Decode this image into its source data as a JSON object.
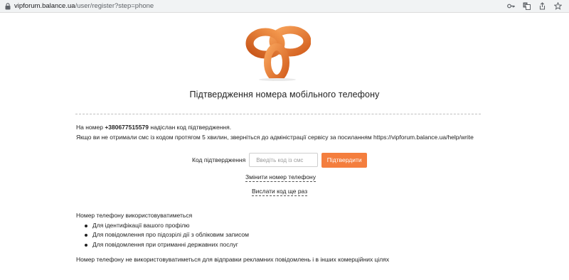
{
  "browser": {
    "url_host": "vipforum.balance.ua",
    "url_path": "/user/register?step=phone"
  },
  "page": {
    "title": "Підтвердження номера мобільного телефону",
    "info_prefix": "На номер ",
    "phone": "+380677515579",
    "info_suffix": " надіслан код підтвердження.",
    "info_line2": "Якщо ви не отримали смс із кодом протягом 5 хвилин, зверніться до адміністрації сервісу за посиланням https://vipforum.balance.ua/help/write"
  },
  "form": {
    "code_label": "Код підтвердження",
    "code_placeholder": "Введіть код із смс",
    "code_value": "",
    "confirm_label": "Підтвердити",
    "change_phone_link": "Змінити номер телефону",
    "resend_link": "Вислати код ще раз"
  },
  "usage": {
    "heading": "Номер телефону використовуватиметься",
    "items": [
      "Для ідентифікації вашого профілю",
      "Для повідомлення про підозрілі дії з обліковим записом",
      "Для повідомлення при отриманні державних послуг"
    ],
    "note": "Номер телефону не використовуватиметься для відправки рекламних повідомлень і в інших комерційних цілях"
  },
  "colors": {
    "accent": "#f47e3e",
    "logo_orange": "#f08a3c"
  },
  "icons": [
    "lock-icon",
    "key-icon",
    "translate-icon",
    "share-icon",
    "star-icon"
  ]
}
